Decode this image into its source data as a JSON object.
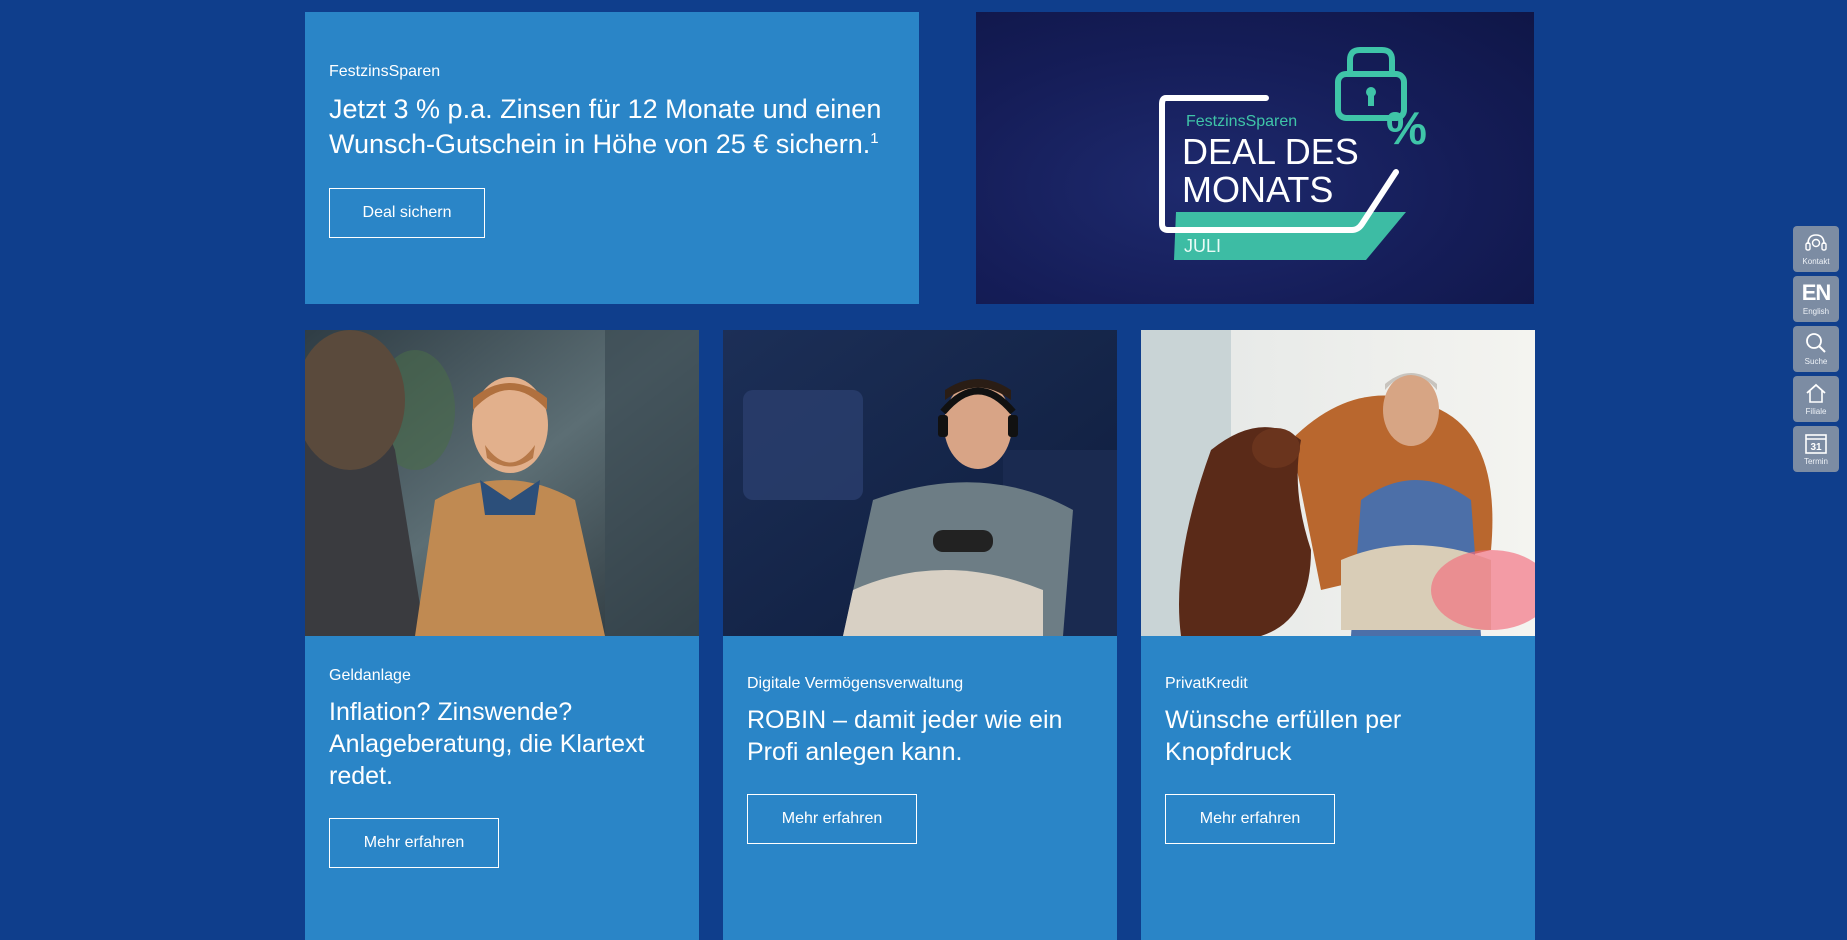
{
  "hero": {
    "eyebrow": "FestzinsSparen",
    "headline": "Jetzt 3 % p.a. Zinsen für 12 Monate und einen Wunsch-Gutschein in Höhe von 25 € sichern.",
    "footnote": "1",
    "button_label": "Deal sichern",
    "badge": {
      "brand": "FestzinsSparen",
      "line1": "DEAL DES",
      "line2": "MONATS",
      "month": "JULI",
      "percent": "%"
    }
  },
  "teasers": [
    {
      "eyebrow": "Geldanlage",
      "headline": "Inflation? Zinswende? Anlageberatung, die Klartext redet.",
      "button_label": "Mehr erfahren"
    },
    {
      "eyebrow": "Digitale Vermögensverwaltung",
      "headline": "ROBIN – damit jeder wie ein Profi anlegen kann.",
      "button_label": "Mehr erfahren"
    },
    {
      "eyebrow": "PrivatKredit",
      "headline": "Wünsche erfüllen per Knopfdruck",
      "button_label": "Mehr erfahren"
    }
  ],
  "rail": {
    "kontakt": "Kontakt",
    "english_glyph": "EN",
    "english": "English",
    "suche": "Suche",
    "filiale": "Filiale",
    "termin_day": "31",
    "termin": "Termin"
  },
  "colors": {
    "page_bg": "#0f3e8c",
    "card_bg": "#2a85c7",
    "rail_bg": "#7c8ca3",
    "badge_teal": "#3fc5a8",
    "badge_navy": "#151d58"
  }
}
